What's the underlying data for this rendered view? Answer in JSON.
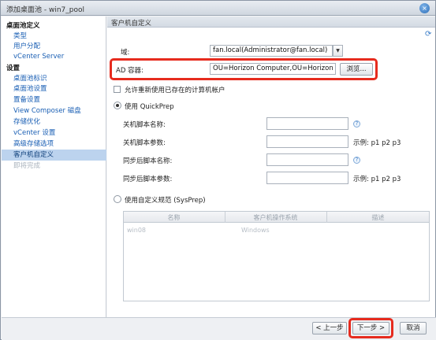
{
  "window": {
    "title": "添加桌面池 - win7_pool",
    "close_glyph": "×"
  },
  "sidebar": {
    "items": [
      {
        "label": "桌面池定义",
        "kind": "head"
      },
      {
        "label": "类型",
        "kind": "item"
      },
      {
        "label": "用户分配",
        "kind": "item"
      },
      {
        "label": "vCenter Server",
        "kind": "item"
      },
      {
        "label": "设置",
        "kind": "head"
      },
      {
        "label": "桌面池标识",
        "kind": "item"
      },
      {
        "label": "桌面池设置",
        "kind": "item"
      },
      {
        "label": "置备设置",
        "kind": "item"
      },
      {
        "label": "View Composer 磁盘",
        "kind": "item"
      },
      {
        "label": "存储优化",
        "kind": "item"
      },
      {
        "label": "vCenter 设置",
        "kind": "item"
      },
      {
        "label": "高级存储选项",
        "kind": "item"
      },
      {
        "label": "客户机自定义",
        "kind": "active"
      },
      {
        "label": "即将完成",
        "kind": "disabled"
      }
    ]
  },
  "main": {
    "header": "客户机自定义",
    "domain": {
      "label": "域:",
      "value": "fan.local(Administrator@fan.local)"
    },
    "ad_container": {
      "label": "AD 容器:",
      "value": "OU=Horizon Computer,OU=Horizon OU",
      "browse_label": "浏览..."
    },
    "reuse_accounts": {
      "label": "允许重新使用已存在的计算机帐户",
      "checked": false
    },
    "quickprep": {
      "label": "使用 QuickPrep",
      "selected": true,
      "fields": [
        {
          "label": "关机脚本名称:",
          "value": "",
          "help": true,
          "example": ""
        },
        {
          "label": "关机脚本参数:",
          "value": "",
          "help": false,
          "example": "示例: p1 p2 p3"
        },
        {
          "label": "同步后脚本名称:",
          "value": "",
          "help": true,
          "example": ""
        },
        {
          "label": "同步后脚本参数:",
          "value": "",
          "help": false,
          "example": "示例: p1 p2 p3"
        }
      ]
    },
    "sysprep": {
      "label": "使用自定义规范 (SysPrep)",
      "selected": false,
      "columns": [
        "名称",
        "客户机操作系统",
        "描述"
      ],
      "rows": [
        {
          "name": "win08",
          "os": "Windows",
          "desc": ""
        }
      ]
    }
  },
  "footer": {
    "back_label": "< 上一步",
    "next_label": "下一步 >",
    "cancel_label": "取消"
  },
  "colors": {
    "highlight_border": "#e62b1e",
    "link": "#1a5fb4",
    "active_bg": "#bcd3ee"
  }
}
